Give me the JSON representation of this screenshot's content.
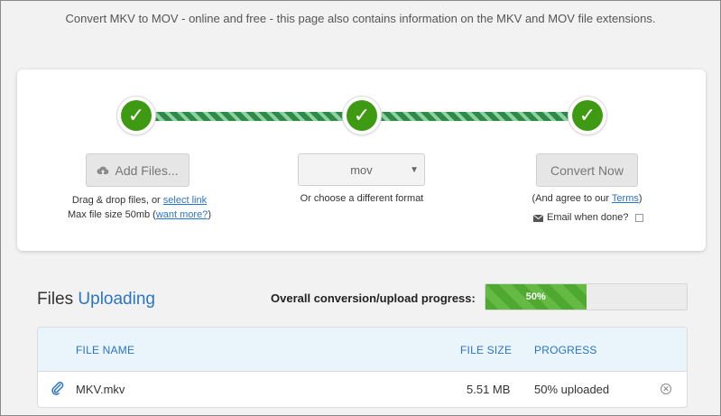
{
  "tagline": "Convert MKV to MOV - online and free - this page also contains information on the MKV and MOV file extensions.",
  "steps": {
    "check_glyph": "✓"
  },
  "add_files": {
    "label": "Add Files...",
    "icon": "cloud-upload-icon",
    "drag_text": "Drag & drop files, or ",
    "select_link": "select link",
    "max_size_text": "Max file size 50mb (",
    "want_more_link": "want more?",
    "max_size_close": ")"
  },
  "format": {
    "selected": "mov",
    "hint": "Or choose a different format"
  },
  "convert": {
    "label": "Convert Now",
    "agree_text": "(And agree to our ",
    "terms_link": "Terms",
    "agree_close": ")",
    "email_label": "Email when done?",
    "email_icon": "envelope-icon"
  },
  "files": {
    "title_prefix": "Files",
    "title_status": "Uploading",
    "overall_label": "Overall conversion/upload progress:",
    "overall_progress": 0.5,
    "overall_progress_text": "50%",
    "columns": {
      "name": "FILE NAME",
      "size": "FILE SIZE",
      "progress": "PROGRESS"
    },
    "rows": [
      {
        "name": "MKV.mkv",
        "size": "5.51 MB",
        "progress": "50% uploaded",
        "icon": "paperclip-icon"
      }
    ]
  },
  "colors": {
    "accent_blue": "#2a75c5",
    "success_green": "#3f9a13"
  }
}
